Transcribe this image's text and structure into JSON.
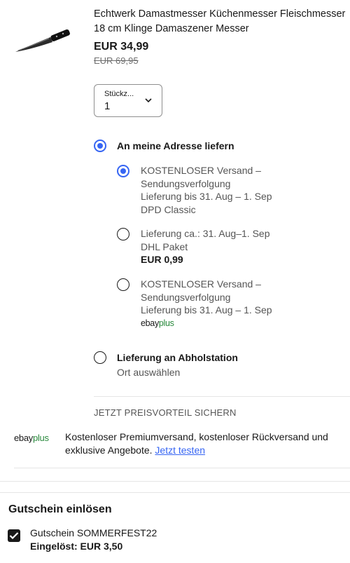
{
  "product": {
    "image_icon": "kitchen-knife-icon",
    "title": "Echtwerk Damastmesser Küchenmesser Fleischmesser 18 cm Klinge Damaszener Messer",
    "price": "EUR 34,99",
    "original_price": "EUR 69,95"
  },
  "quantity": {
    "label": "Stückz...",
    "value": "1"
  },
  "delivery": {
    "home": {
      "label": "An meine Adresse liefern",
      "selected": true,
      "options": [
        {
          "selected": true,
          "line1": "KOSTENLOSER Versand –",
          "line2": "Sendungsverfolgung",
          "line3": "Lieferung bis 31. Aug – 1. Sep",
          "line4": "DPD Classic"
        },
        {
          "selected": false,
          "line1": "Lieferung ca.: 31. Aug–1. Sep",
          "line2": "DHL Paket",
          "price": "EUR 0,99"
        },
        {
          "selected": false,
          "line1": "KOSTENLOSER Versand –",
          "line2": "Sendungsverfolgung",
          "line3": "Lieferung bis 31. Aug – 1. Sep",
          "badge_ebay": "ebay",
          "badge_plus": "plus"
        }
      ]
    },
    "pickup": {
      "label": "Lieferung an Abholstation",
      "sub": "Ort auswählen",
      "selected": false
    }
  },
  "promo": {
    "heading": "JETZT PREISVORTEIL SICHERN",
    "logo_ebay": "ebay",
    "logo_plus": "plus",
    "text": "Kostenloser Premiumversand, kostenloser Rückversand und exklusive Angebote.",
    "link": "Jetzt testen"
  },
  "voucher": {
    "heading": "Gutschein einlösen",
    "checked": true,
    "code": "Gutschein SOMMERFEST22",
    "redeemed": "Eingelöst: EUR 3,50"
  },
  "colors": {
    "accent_blue": "#3665f3",
    "plus_green": "#2b8a3e",
    "text": "#191919",
    "muted": "#555555"
  }
}
